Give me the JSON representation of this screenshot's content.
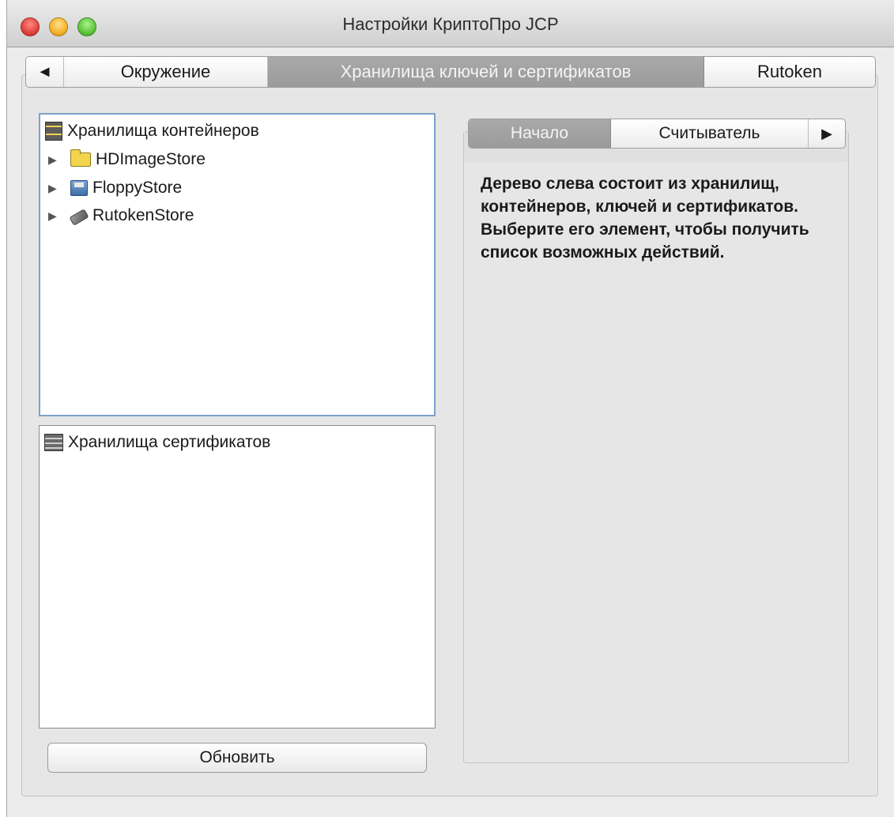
{
  "window": {
    "title": "Настройки КриптоПро JCP"
  },
  "main_tabs": {
    "scroll_left": "◄",
    "items": [
      {
        "label": "Окружение",
        "active": false
      },
      {
        "label": "Хранилища ключей и сертификатов",
        "active": true
      },
      {
        "label": "Rutoken",
        "active": false
      }
    ]
  },
  "containers_tree": {
    "root_label": "Хранилища контейнеров",
    "root_icon": "server-stack-icon",
    "children": [
      {
        "label": "HDImageStore",
        "icon": "folder-icon",
        "expander": "▶"
      },
      {
        "label": "FloppyStore",
        "icon": "floppy-icon",
        "expander": "▶"
      },
      {
        "label": "RutokenStore",
        "icon": "usb-token-icon",
        "expander": "▶"
      }
    ]
  },
  "certs_tree": {
    "root_label": "Хранилища сертификатов",
    "root_icon": "cert-stack-icon"
  },
  "refresh_button": {
    "label": "Обновить"
  },
  "sub_tabs": {
    "items": [
      {
        "label": "Начало",
        "active": true
      },
      {
        "label": "Считыватель",
        "active": false
      }
    ],
    "scroll_right": "▶"
  },
  "description": {
    "text": "Дерево слева состоит из хранилищ, контейнеров, ключей и сертификатов. Выберите его элемент, чтобы получить список возможных действий."
  },
  "colors": {
    "window_bg": "#ececec",
    "active_tab_bg": "#a3a3a3",
    "tree_focus_border": "#7ea0cc"
  }
}
